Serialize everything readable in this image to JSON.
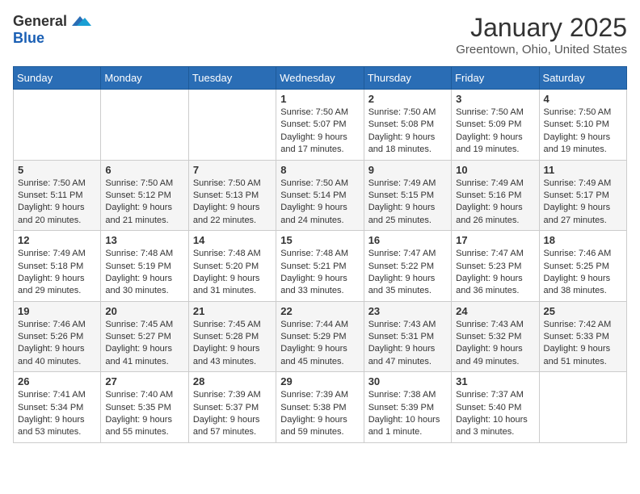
{
  "header": {
    "logo_general": "General",
    "logo_blue": "Blue",
    "month": "January 2025",
    "location": "Greentown, Ohio, United States"
  },
  "weekdays": [
    "Sunday",
    "Monday",
    "Tuesday",
    "Wednesday",
    "Thursday",
    "Friday",
    "Saturday"
  ],
  "weeks": [
    [
      {
        "day": "",
        "sunrise": "",
        "sunset": "",
        "daylight": ""
      },
      {
        "day": "",
        "sunrise": "",
        "sunset": "",
        "daylight": ""
      },
      {
        "day": "",
        "sunrise": "",
        "sunset": "",
        "daylight": ""
      },
      {
        "day": "1",
        "sunrise": "Sunrise: 7:50 AM",
        "sunset": "Sunset: 5:07 PM",
        "daylight": "Daylight: 9 hours and 17 minutes."
      },
      {
        "day": "2",
        "sunrise": "Sunrise: 7:50 AM",
        "sunset": "Sunset: 5:08 PM",
        "daylight": "Daylight: 9 hours and 18 minutes."
      },
      {
        "day": "3",
        "sunrise": "Sunrise: 7:50 AM",
        "sunset": "Sunset: 5:09 PM",
        "daylight": "Daylight: 9 hours and 19 minutes."
      },
      {
        "day": "4",
        "sunrise": "Sunrise: 7:50 AM",
        "sunset": "Sunset: 5:10 PM",
        "daylight": "Daylight: 9 hours and 19 minutes."
      }
    ],
    [
      {
        "day": "5",
        "sunrise": "Sunrise: 7:50 AM",
        "sunset": "Sunset: 5:11 PM",
        "daylight": "Daylight: 9 hours and 20 minutes."
      },
      {
        "day": "6",
        "sunrise": "Sunrise: 7:50 AM",
        "sunset": "Sunset: 5:12 PM",
        "daylight": "Daylight: 9 hours and 21 minutes."
      },
      {
        "day": "7",
        "sunrise": "Sunrise: 7:50 AM",
        "sunset": "Sunset: 5:13 PM",
        "daylight": "Daylight: 9 hours and 22 minutes."
      },
      {
        "day": "8",
        "sunrise": "Sunrise: 7:50 AM",
        "sunset": "Sunset: 5:14 PM",
        "daylight": "Daylight: 9 hours and 24 minutes."
      },
      {
        "day": "9",
        "sunrise": "Sunrise: 7:49 AM",
        "sunset": "Sunset: 5:15 PM",
        "daylight": "Daylight: 9 hours and 25 minutes."
      },
      {
        "day": "10",
        "sunrise": "Sunrise: 7:49 AM",
        "sunset": "Sunset: 5:16 PM",
        "daylight": "Daylight: 9 hours and 26 minutes."
      },
      {
        "day": "11",
        "sunrise": "Sunrise: 7:49 AM",
        "sunset": "Sunset: 5:17 PM",
        "daylight": "Daylight: 9 hours and 27 minutes."
      }
    ],
    [
      {
        "day": "12",
        "sunrise": "Sunrise: 7:49 AM",
        "sunset": "Sunset: 5:18 PM",
        "daylight": "Daylight: 9 hours and 29 minutes."
      },
      {
        "day": "13",
        "sunrise": "Sunrise: 7:48 AM",
        "sunset": "Sunset: 5:19 PM",
        "daylight": "Daylight: 9 hours and 30 minutes."
      },
      {
        "day": "14",
        "sunrise": "Sunrise: 7:48 AM",
        "sunset": "Sunset: 5:20 PM",
        "daylight": "Daylight: 9 hours and 31 minutes."
      },
      {
        "day": "15",
        "sunrise": "Sunrise: 7:48 AM",
        "sunset": "Sunset: 5:21 PM",
        "daylight": "Daylight: 9 hours and 33 minutes."
      },
      {
        "day": "16",
        "sunrise": "Sunrise: 7:47 AM",
        "sunset": "Sunset: 5:22 PM",
        "daylight": "Daylight: 9 hours and 35 minutes."
      },
      {
        "day": "17",
        "sunrise": "Sunrise: 7:47 AM",
        "sunset": "Sunset: 5:23 PM",
        "daylight": "Daylight: 9 hours and 36 minutes."
      },
      {
        "day": "18",
        "sunrise": "Sunrise: 7:46 AM",
        "sunset": "Sunset: 5:25 PM",
        "daylight": "Daylight: 9 hours and 38 minutes."
      }
    ],
    [
      {
        "day": "19",
        "sunrise": "Sunrise: 7:46 AM",
        "sunset": "Sunset: 5:26 PM",
        "daylight": "Daylight: 9 hours and 40 minutes."
      },
      {
        "day": "20",
        "sunrise": "Sunrise: 7:45 AM",
        "sunset": "Sunset: 5:27 PM",
        "daylight": "Daylight: 9 hours and 41 minutes."
      },
      {
        "day": "21",
        "sunrise": "Sunrise: 7:45 AM",
        "sunset": "Sunset: 5:28 PM",
        "daylight": "Daylight: 9 hours and 43 minutes."
      },
      {
        "day": "22",
        "sunrise": "Sunrise: 7:44 AM",
        "sunset": "Sunset: 5:29 PM",
        "daylight": "Daylight: 9 hours and 45 minutes."
      },
      {
        "day": "23",
        "sunrise": "Sunrise: 7:43 AM",
        "sunset": "Sunset: 5:31 PM",
        "daylight": "Daylight: 9 hours and 47 minutes."
      },
      {
        "day": "24",
        "sunrise": "Sunrise: 7:43 AM",
        "sunset": "Sunset: 5:32 PM",
        "daylight": "Daylight: 9 hours and 49 minutes."
      },
      {
        "day": "25",
        "sunrise": "Sunrise: 7:42 AM",
        "sunset": "Sunset: 5:33 PM",
        "daylight": "Daylight: 9 hours and 51 minutes."
      }
    ],
    [
      {
        "day": "26",
        "sunrise": "Sunrise: 7:41 AM",
        "sunset": "Sunset: 5:34 PM",
        "daylight": "Daylight: 9 hours and 53 minutes."
      },
      {
        "day": "27",
        "sunrise": "Sunrise: 7:40 AM",
        "sunset": "Sunset: 5:35 PM",
        "daylight": "Daylight: 9 hours and 55 minutes."
      },
      {
        "day": "28",
        "sunrise": "Sunrise: 7:39 AM",
        "sunset": "Sunset: 5:37 PM",
        "daylight": "Daylight: 9 hours and 57 minutes."
      },
      {
        "day": "29",
        "sunrise": "Sunrise: 7:39 AM",
        "sunset": "Sunset: 5:38 PM",
        "daylight": "Daylight: 9 hours and 59 minutes."
      },
      {
        "day": "30",
        "sunrise": "Sunrise: 7:38 AM",
        "sunset": "Sunset: 5:39 PM",
        "daylight": "Daylight: 10 hours and 1 minute."
      },
      {
        "day": "31",
        "sunrise": "Sunrise: 7:37 AM",
        "sunset": "Sunset: 5:40 PM",
        "daylight": "Daylight: 10 hours and 3 minutes."
      },
      {
        "day": "",
        "sunrise": "",
        "sunset": "",
        "daylight": ""
      }
    ]
  ]
}
